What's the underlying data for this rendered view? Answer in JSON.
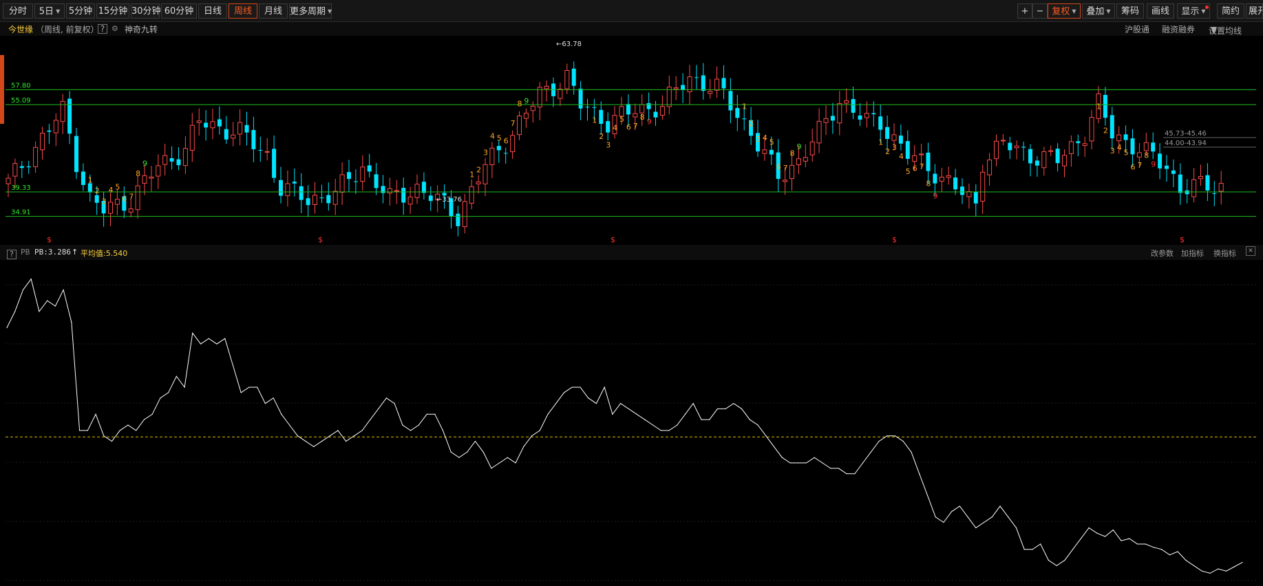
{
  "toolbar": {
    "periods": [
      {
        "label": "分时",
        "active": false,
        "caret": false
      },
      {
        "label": "5日",
        "active": false,
        "caret": true
      },
      {
        "label": "5分钟",
        "active": false,
        "caret": false
      },
      {
        "label": "15分钟",
        "active": false,
        "caret": false
      },
      {
        "label": "30分钟",
        "active": false,
        "caret": false
      },
      {
        "label": "60分钟",
        "active": false,
        "caret": false
      },
      {
        "label": "日线",
        "active": false,
        "caret": false
      },
      {
        "label": "周线",
        "active": true,
        "caret": false
      },
      {
        "label": "月线",
        "active": false,
        "caret": false
      },
      {
        "label": "更多周期",
        "active": false,
        "caret": true
      }
    ],
    "zoom_in": "+",
    "zoom_out": "−",
    "fuquan": "复权",
    "overlay": "叠加",
    "chips": "筹码",
    "draw": "画线",
    "display": "显示",
    "simple": "简约",
    "expand": "展开"
  },
  "info": {
    "stock_name": "今世缘",
    "period_info": "（周线, 前复权）",
    "help": "?",
    "indicator": "神奇九转",
    "links": [
      "沪股通",
      "融资融券",
      "设置均线"
    ]
  },
  "price_chart": {
    "levels": [
      "57.80",
      "55.09",
      "39.33",
      "34.91"
    ],
    "high_label": "63.78",
    "low_label": "33.76",
    "range_labels": [
      "45.73-45.46",
      "44.00-43.94"
    ],
    "markers": "$"
  },
  "indicator_bar": {
    "help": "?",
    "name": "PB",
    "value_label": "PB:3.286",
    "arrow": "↑",
    "avg_label": "平均值:5.540",
    "actions": [
      "改参数",
      "加指标",
      "换指标"
    ],
    "close": "✕"
  },
  "colors": {
    "up": "#ff4a4a",
    "down": "#00e4ff",
    "level_line": "#1fbf1f",
    "avg_line": "#e0c000",
    "accent": "#ff5a1f"
  },
  "chart_data": {
    "type": "line",
    "title": "",
    "series": [
      {
        "name": "PB",
        "values": [
          6.55,
          6.7,
          6.9,
          7.0,
          6.7,
          6.8,
          6.75,
          6.9,
          6.6,
          5.6,
          5.6,
          5.75,
          5.55,
          5.5,
          5.6,
          5.65,
          5.6,
          5.7,
          5.75,
          5.9,
          5.95,
          6.1,
          6.0,
          6.5,
          6.4,
          6.45,
          6.4,
          6.45,
          6.2,
          5.95,
          6.0,
          6.0,
          5.85,
          5.9,
          5.75,
          5.65,
          5.55,
          5.5,
          5.45,
          5.5,
          5.55,
          5.6,
          5.5,
          5.55,
          5.6,
          5.7,
          5.8,
          5.9,
          5.85,
          5.65,
          5.6,
          5.65,
          5.75,
          5.75,
          5.6,
          5.4,
          5.35,
          5.4,
          5.5,
          5.4,
          5.25,
          5.3,
          5.35,
          5.3,
          5.45,
          5.55,
          5.6,
          5.75,
          5.85,
          5.95,
          6.0,
          6.0,
          5.9,
          5.85,
          6.0,
          5.75,
          5.85,
          5.8,
          5.75,
          5.7,
          5.65,
          5.6,
          5.6,
          5.65,
          5.75,
          5.85,
          5.7,
          5.7,
          5.8,
          5.8,
          5.85,
          5.8,
          5.7,
          5.65,
          5.55,
          5.45,
          5.35,
          5.3,
          5.3,
          5.3,
          5.35,
          5.3,
          5.25,
          5.25,
          5.2,
          5.2,
          5.3,
          5.4,
          5.5,
          5.55,
          5.55,
          5.5,
          5.4,
          5.2,
          5.0,
          4.8,
          4.75,
          4.85,
          4.9,
          4.8,
          4.7,
          4.75,
          4.8,
          4.9,
          4.8,
          4.7,
          4.5,
          4.5,
          4.55,
          4.4,
          4.35,
          4.4,
          4.5,
          4.6,
          4.7,
          4.65,
          4.62,
          4.68,
          4.58,
          4.6,
          4.55,
          4.55,
          4.52,
          4.5,
          4.45,
          4.48,
          4.4,
          4.35,
          4.3,
          4.28,
          4.32,
          4.3,
          4.34,
          4.38
        ]
      }
    ],
    "average": 5.54,
    "last_value": 3.286
  }
}
